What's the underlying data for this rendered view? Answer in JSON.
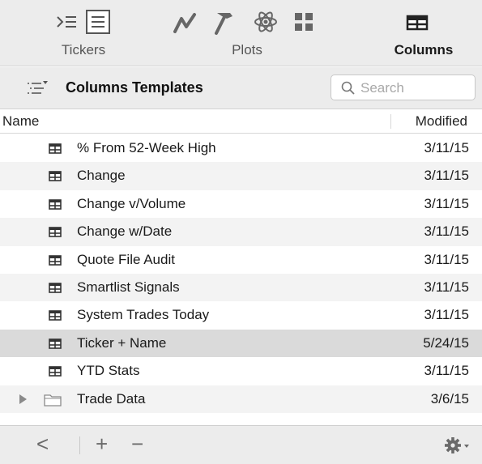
{
  "toolbar": {
    "tabs": [
      {
        "label": "Tickers",
        "icons": [
          "list-indent-icon",
          "document-list-icon"
        ]
      },
      {
        "label": "Plots",
        "icons": [
          "line-chart-icon",
          "hammer-icon",
          "atom-icon",
          "grid-icon"
        ]
      },
      {
        "label": "Columns",
        "icons": [
          "table-columns-icon"
        ],
        "active": true
      }
    ]
  },
  "templates": {
    "title": "Columns Templates",
    "search_placeholder": "Search"
  },
  "table": {
    "columns": [
      "Name",
      "Modified"
    ],
    "rows": [
      {
        "name": "% From 52-Week High",
        "modified": "3/11/15",
        "type": "template"
      },
      {
        "name": "Change",
        "modified": "3/11/15",
        "type": "template"
      },
      {
        "name": "Change v/Volume",
        "modified": "3/11/15",
        "type": "template"
      },
      {
        "name": "Change w/Date",
        "modified": "3/11/15",
        "type": "template"
      },
      {
        "name": "Quote File Audit",
        "modified": "3/11/15",
        "type": "template"
      },
      {
        "name": "Smartlist Signals",
        "modified": "3/11/15",
        "type": "template"
      },
      {
        "name": "System Trades Today",
        "modified": "3/11/15",
        "type": "template"
      },
      {
        "name": "Ticker + Name",
        "modified": "5/24/15",
        "type": "template",
        "selected": true
      },
      {
        "name": "YTD Stats",
        "modified": "3/11/15",
        "type": "template"
      },
      {
        "name": "Trade Data",
        "modified": "3/6/15",
        "type": "folder"
      }
    ]
  },
  "bottom_bar": {
    "back": "<",
    "add": "+",
    "remove": "−",
    "gear": "gear-menu-icon"
  },
  "colors": {
    "toolbar_bg": "#ececec",
    "selected_row": "#dadada",
    "alt_row": "#f3f3f3"
  }
}
